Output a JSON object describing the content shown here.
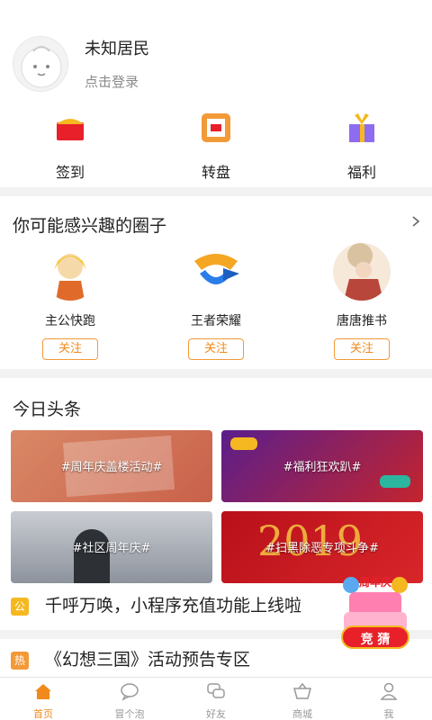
{
  "profile": {
    "name": "未知居民",
    "login": "点击登录"
  },
  "actions": [
    {
      "label": "签到",
      "icon": "red-envelope-icon"
    },
    {
      "label": "转盘",
      "icon": "wheel-icon"
    },
    {
      "label": "福利",
      "icon": "gift-icon"
    }
  ],
  "circles": {
    "title": "你可能感兴趣的圈子",
    "items": [
      {
        "name": "主公快跑",
        "follow": "关注"
      },
      {
        "name": "王者荣耀",
        "follow": "关注"
      },
      {
        "name": "唐唐推书",
        "follow": "关注"
      }
    ]
  },
  "news": {
    "title": "今日头条",
    "tiles": [
      {
        "caption": "#周年庆盖楼活动#"
      },
      {
        "caption": "#福利狂欢趴#"
      },
      {
        "caption": "#社区周年庆#"
      },
      {
        "caption": "#扫黑除恶专项斗争#"
      }
    ],
    "headlines": [
      {
        "tag": "公",
        "text": "千呼万唤，小程序充值功能上线啦",
        "tag_color": "#f5b821"
      },
      {
        "tag": "热",
        "text": "《幻想三国》活动预告专区",
        "tag_color": "#f29a38"
      }
    ]
  },
  "promo": {
    "top": "周年庆",
    "button": "竞 猜"
  },
  "tabs": [
    {
      "label": "首页",
      "active": true
    },
    {
      "label": "冒个泡",
      "active": false
    },
    {
      "label": "好友",
      "active": false
    },
    {
      "label": "商城",
      "active": false
    },
    {
      "label": "我",
      "active": false
    }
  ],
  "colors": {
    "accent": "#f08a1c"
  }
}
